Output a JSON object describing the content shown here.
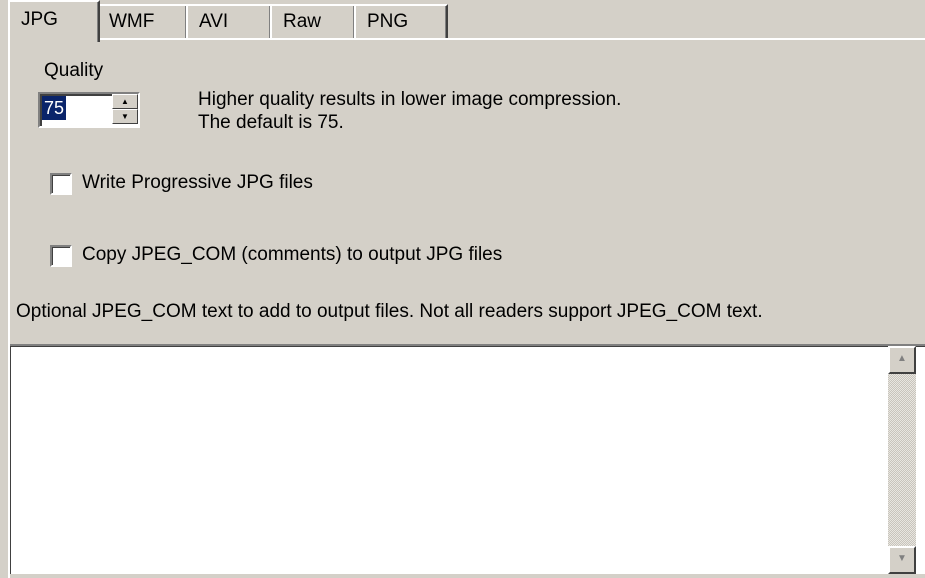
{
  "tabs": [
    {
      "label": "JPG",
      "active": true
    },
    {
      "label": "WMF",
      "active": false
    },
    {
      "label": "AVI",
      "active": false
    },
    {
      "label": "Raw",
      "active": false
    },
    {
      "label": "PNG",
      "active": false
    }
  ],
  "quality": {
    "label": "Quality",
    "value": "75",
    "hint_line1": "Higher quality results in lower image compression.",
    "hint_line2": "The default is 75."
  },
  "options": {
    "progressive_label": "Write Progressive JPG files",
    "progressive_checked": false,
    "copy_com_label": "Copy JPEG_COM (comments) to output JPG files",
    "copy_com_checked": false
  },
  "comment": {
    "label": "Optional JPEG_COM text to add to output files. Not all readers support JPEG_COM text.",
    "value": ""
  },
  "icons": {
    "spin_up": "up-arrow-icon",
    "spin_down": "down-arrow-icon",
    "scroll_up": "scroll-up-arrow-icon",
    "scroll_down": "scroll-down-arrow-icon"
  },
  "colors": {
    "dialog_bg": "#d4d0c8",
    "selection_bg": "#0a246a"
  }
}
